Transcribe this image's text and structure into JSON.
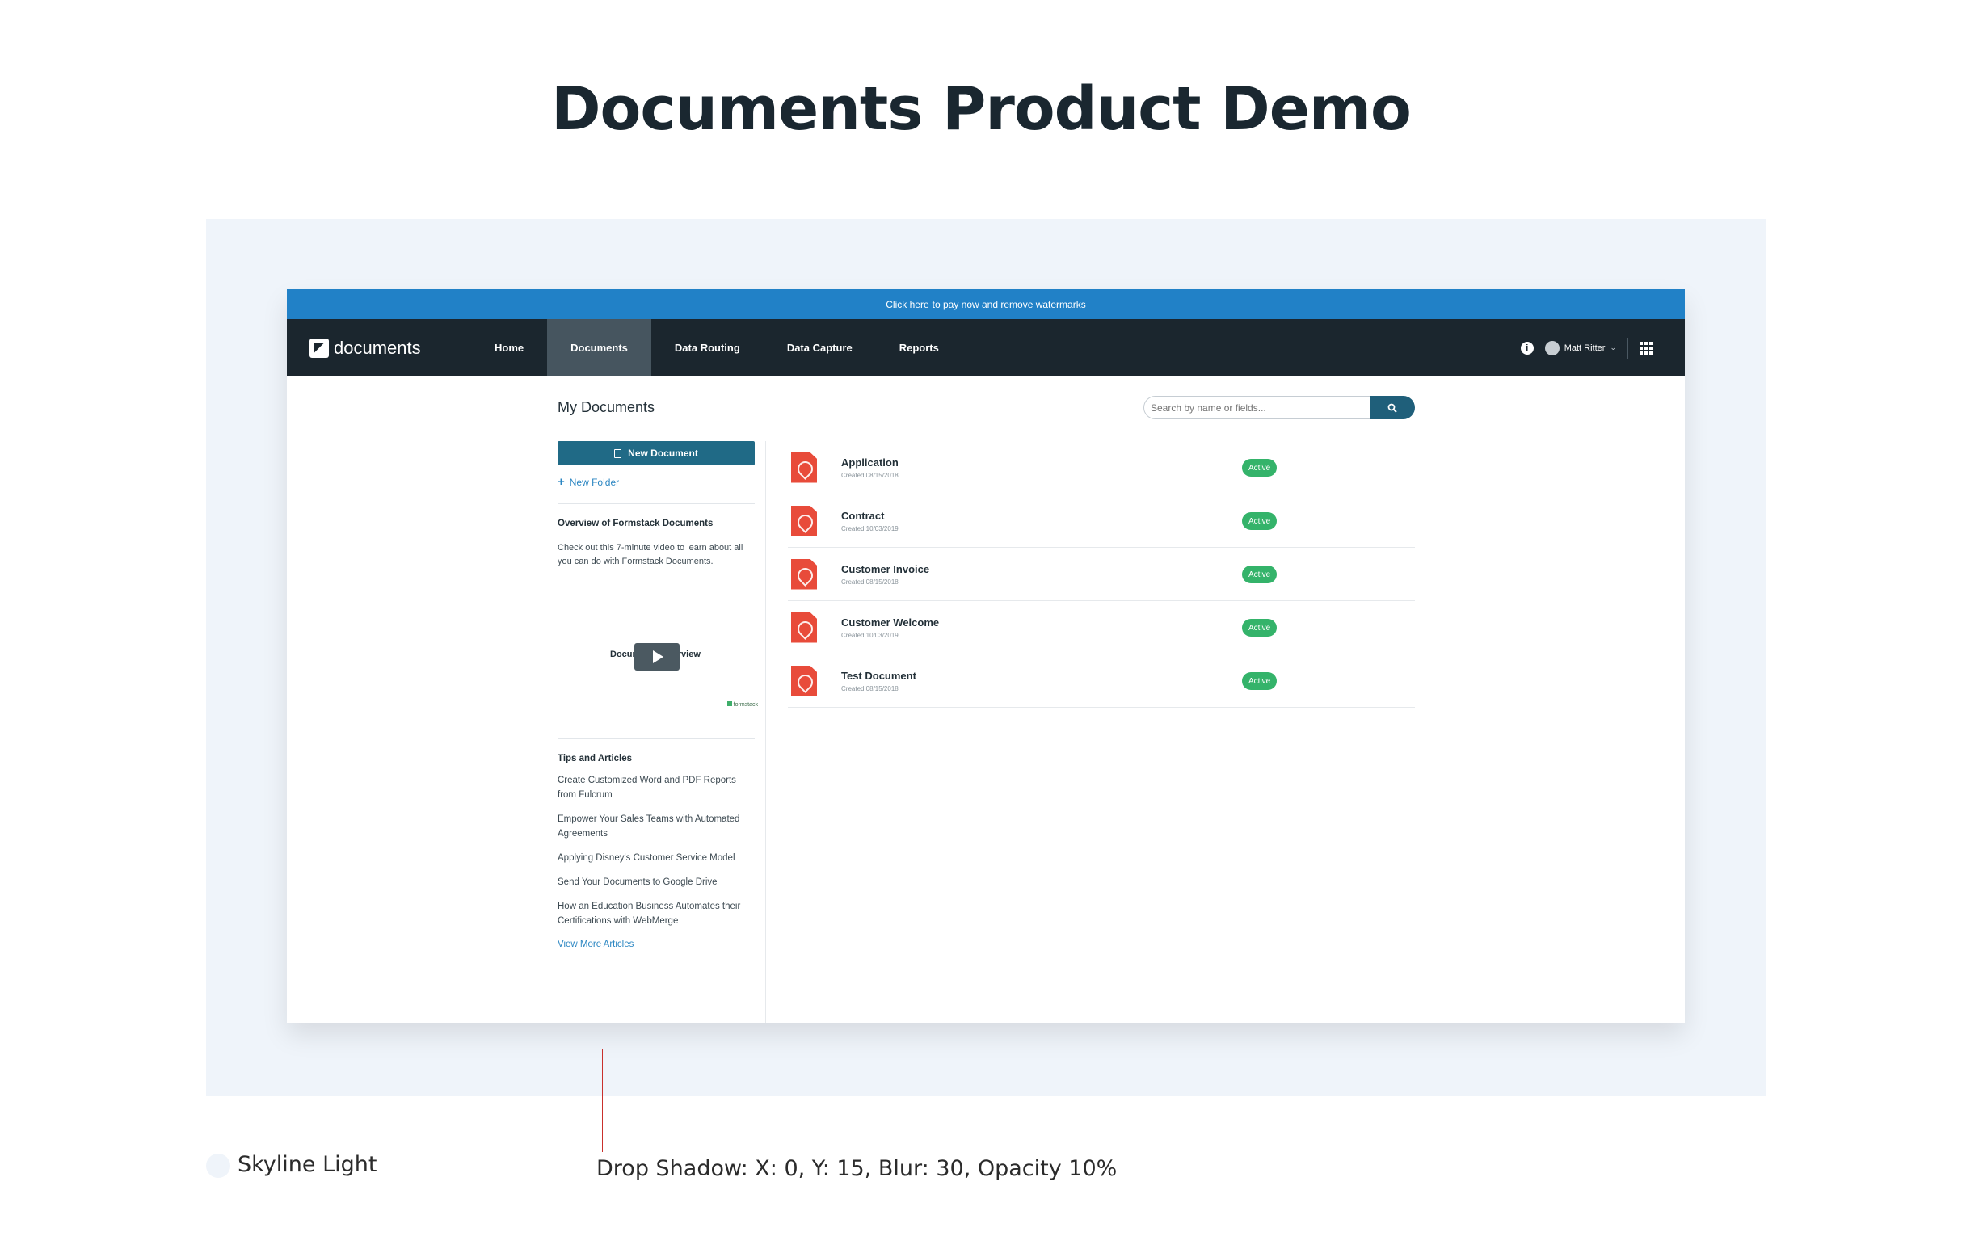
{
  "page": {
    "title": "Documents Product Demo"
  },
  "banner": {
    "link_text": "Click here",
    "text": "to pay now and remove watermarks"
  },
  "navbar": {
    "brand": "documents",
    "items": [
      {
        "label": "Home"
      },
      {
        "label": "Documents",
        "active": true
      },
      {
        "label": "Data Routing"
      },
      {
        "label": "Data Capture"
      },
      {
        "label": "Reports"
      }
    ],
    "user_name": "Matt Ritter",
    "icons": [
      "info-icon",
      "avatar",
      "chevron-down-icon",
      "apps-grid-icon"
    ]
  },
  "main": {
    "heading": "My Documents",
    "search": {
      "placeholder": "Search by name or fields..."
    }
  },
  "sidebar": {
    "new_document_label": "New Document",
    "new_folder_label": "New Folder",
    "overview_heading": "Overview of Formstack Documents",
    "overview_text": "Check out this 7-minute video to learn about all you can do with Formstack Documents.",
    "video_title": "Documents Overview",
    "video_brand": "formstack",
    "tips_heading": "Tips and Articles",
    "tips": [
      "Create Customized Word and PDF Reports from Fulcrum",
      "Empower Your Sales Teams with Automated Agreements",
      "Applying Disney's Customer Service Model",
      "Send Your Documents to Google Drive",
      "How an Education Business Automates their Certifications with WebMerge"
    ],
    "more_articles_label": "View More Articles"
  },
  "documents": [
    {
      "name": "Application",
      "created": "Created 08/15/2018",
      "status": "Active"
    },
    {
      "name": "Contract",
      "created": "Created 10/03/2019",
      "status": "Active"
    },
    {
      "name": "Customer Invoice",
      "created": "Created 08/15/2018",
      "status": "Active"
    },
    {
      "name": "Customer Welcome",
      "created": "Created 10/03/2019",
      "status": "Active"
    },
    {
      "name": "Test Document",
      "created": "Created 08/15/2018",
      "status": "Active"
    }
  ],
  "annotations": {
    "swatch_label": "Skyline Light",
    "shadow_label": "Drop Shadow: X: 0, Y: 15, Blur: 30, Opacity 10%"
  },
  "colors": {
    "backdrop": "#eff4fa",
    "banner": "#2181c7",
    "navbar": "#1b262e",
    "primary_button": "#206a86",
    "status_active": "#34b36a",
    "pdf_icon": "#e84b3a"
  }
}
